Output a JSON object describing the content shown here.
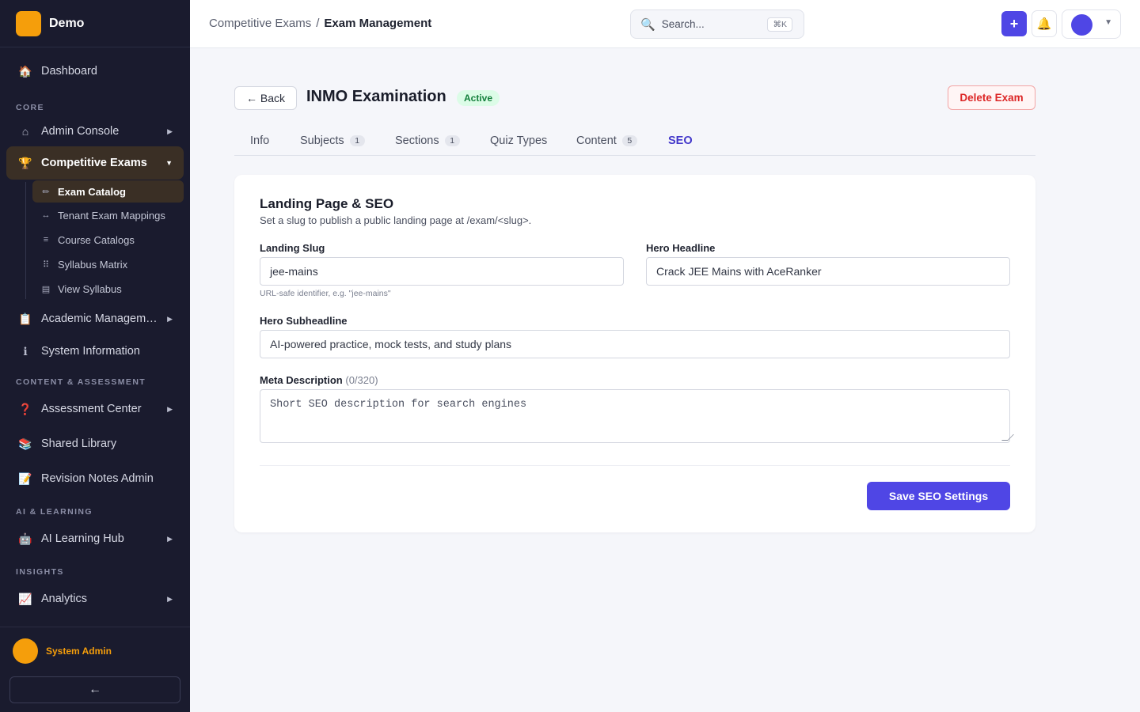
{
  "brand": {
    "name": "Demo"
  },
  "sidebar": {
    "dashboard": {
      "label": "Dashboard",
      "icon": "house-icon"
    },
    "sections": {
      "core": "CORE",
      "content": "CONTENT & ASSESSMENT",
      "ai": "AI & LEARNING",
      "insights": "INSIGHTS"
    },
    "items": {
      "admin_console": "Admin Console",
      "competitive_exams": "Competitive Exams",
      "academic": "Academic Management",
      "system_info": "System Information",
      "assessment": "Assessment Center",
      "shared_library": "Shared Library",
      "revision_notes": "Revision Notes Admin",
      "ai_hub": "AI Learning Hub",
      "analytics": "Analytics"
    },
    "sub_items": {
      "exam_catalog": "Exam Catalog",
      "tenant_mappings": "Tenant Exam Mappings",
      "course_catalogs": "Course Catalogs",
      "syllabus_matrix": "Syllabus Matrix",
      "view_syllabus": "View Syllabus"
    },
    "user": {
      "name": "System Admin"
    },
    "collapse_label": "←"
  },
  "topbar": {
    "breadcrumb": {
      "parent": "Competitive Exams",
      "separator": "/",
      "current": "Exam Management"
    },
    "search": {
      "placeholder": "Search...",
      "shortcut": "⌘K"
    },
    "add_label": "+"
  },
  "page": {
    "back_label": "← Back",
    "title": "INMO Examination",
    "status": "Active",
    "delete_label": "Delete Exam"
  },
  "tabs": [
    {
      "label": "Info",
      "count": null
    },
    {
      "label": "Subjects",
      "count": "1"
    },
    {
      "label": "Sections",
      "count": "1"
    },
    {
      "label": "Quiz Types",
      "count": null
    },
    {
      "label": "Content",
      "count": "5"
    },
    {
      "label": "SEO",
      "count": null,
      "active": true
    }
  ],
  "seo_form": {
    "title": "Landing Page & SEO",
    "description": "Set a slug to publish a public landing page at /exam/<slug>.",
    "slug": {
      "label": "Landing Slug",
      "value": "jee-mains",
      "hint": "URL-safe identifier, e.g. \"jee-mains\""
    },
    "headline": {
      "label": "Hero Headline",
      "value": "Crack JEE Mains with AceRanker"
    },
    "subheadline": {
      "label": "Hero Subheadline",
      "value": "AI-powered practice, mock tests, and study plans"
    },
    "meta": {
      "label": "Meta Description",
      "counter": "(0/320)",
      "placeholder": "Short SEO description for search engines"
    },
    "save_label": "Save SEO Settings"
  },
  "colors": {
    "accent": "#4f46e5",
    "brand": "#f59e0b",
    "sidebar_bg": "#1a1b2e",
    "danger": "#dc2626",
    "success": "#15803d"
  }
}
